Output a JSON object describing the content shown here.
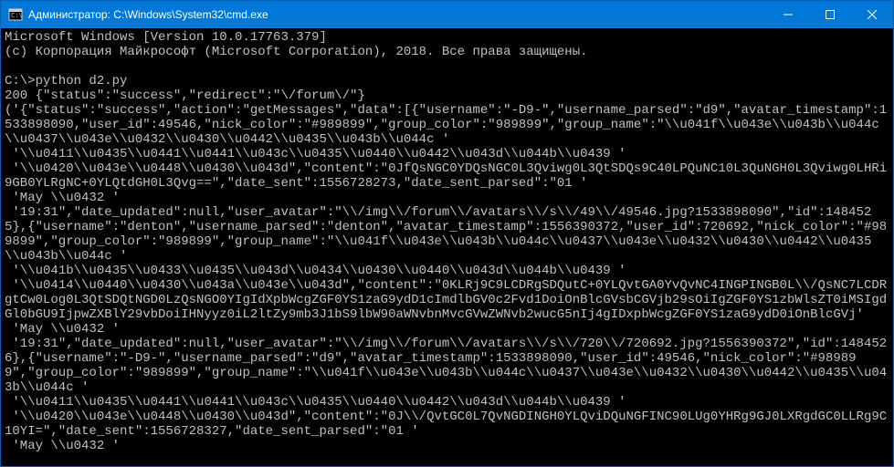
{
  "titlebar": {
    "title": "Администратор: C:\\Windows\\System32\\cmd.exe"
  },
  "terminal": {
    "lines": [
      "Microsoft Windows [Version 10.0.17763.379]",
      "(c) Корпорация Майкрософт (Microsoft Corporation), 2018. Все права защищены.",
      "",
      "C:\\>python d2.py",
      "200 {\"status\":\"success\",\"redirect\":\"\\/forum\\/\"}",
      "('{\"status\":\"success\",\"action\":\"getMessages\",\"data\":[{\"username\":\"-D9-\",\"username_parsed\":\"d9\",\"avatar_timestamp\":1533898090,\"user_id\":49546,\"nick_color\":\"#989899\",\"group_color\":\"989899\",\"group_name\":\"\\\\u041f\\\\u043e\\\\u043b\\\\u044c\\\\u0437\\\\u043e\\\\u0432\\\\u0430\\\\u0442\\\\u0435\\\\u043b\\\\u044c '",
      " '\\\\u0411\\\\u0435\\\\u0441\\\\u0441\\\\u043c\\\\u0435\\\\u0440\\\\u0442\\\\u043d\\\\u044b\\\\u0439 '",
      " '\\\\u0420\\\\u043e\\\\u0448\\\\u0430\\\\u043d\",\"content\":\"0JfQsNGC0YDQsNGC0L3Qviwg0L3QtSDQs9C40LPQuNC10L3QuNGH0L3Qviwg0LHRi9GB0YLRgNC+0YLQtdGH0L3Qvg==\",\"date_sent\":1556728273,\"date_sent_parsed\":\"01 '",
      " 'May \\\\u0432 '",
      " '19:31\",\"date_updated\":null,\"user_avatar\":\"\\\\/img\\\\/forum\\\\/avatars\\\\/s\\\\/49\\\\/49546.jpg?1533898090\",\"id\":1484525},{\"username\":\"denton\",\"username_parsed\":\"denton\",\"avatar_timestamp\":1556390372,\"user_id\":720692,\"nick_color\":\"#989899\",\"group_color\":\"989899\",\"group_name\":\"\\\\u041f\\\\u043e\\\\u043b\\\\u044c\\\\u0437\\\\u043e\\\\u0432\\\\u0430\\\\u0442\\\\u0435\\\\u043b\\\\u044c '",
      " '\\\\u041b\\\\u0435\\\\u0433\\\\u0435\\\\u043d\\\\u0434\\\\u0430\\\\u0440\\\\u043d\\\\u044b\\\\u0439 '",
      " '\\\\u0414\\\\u0440\\\\u0430\\\\u043a\\\\u043e\\\\u043d\",\"content\":\"0KLRj9C9LCDRgSDQutC+0YLQvtGA0YvQvNC4INGPINGB0L\\\\/QsNC7LCDRgtCw0Log0L3QtSDQtNGD0LzQsNGO0YIgIdXpbWcgZGF0YS1zaG9ydD1cImdlbGV0c2Fvd1DoiOnBlcGVsbCGVjb29sOiIgZGF0YS1zbWlsZT0iMSIgdGl0bGU9IjpwZXBlY29vbDoiIHNyyz0iL2ltZy9mb3J1bS9lbW90aWNvbnMvcGVwZWNvb2wucG5nIj4gIDxpbWcgZGF0YS1zaG9ydD0iOnBlcGVj'",
      " 'May \\\\u0432 '",
      " '19:31\",\"date_updated\":null,\"user_avatar\":\"\\\\/img\\\\/forum\\\\/avatars\\\\/s\\\\/720\\\\/720692.jpg?1556390372\",\"id\":1484526},{\"username\":\"-D9-\",\"username_parsed\":\"d9\",\"avatar_timestamp\":1533898090,\"user_id\":49546,\"nick_color\":\"#989899\",\"group_color\":\"989899\",\"group_name\":\"\\\\u041f\\\\u043e\\\\u043b\\\\u044c\\\\u0437\\\\u043e\\\\u0432\\\\u0430\\\\u0442\\\\u0435\\\\u043b\\\\u044c '",
      " '\\\\u0411\\\\u0435\\\\u0441\\\\u0441\\\\u043c\\\\u0435\\\\u0440\\\\u0442\\\\u043d\\\\u044b\\\\u0439 '",
      " '\\\\u0420\\\\u043e\\\\u0448\\\\u0430\\\\u043d\",\"content\":\"0J\\\\/QvtGC0L7QvNGDINGH0YLQviDQuNGFINC90LUg0YHRg9GJ0LXRgdGC0LLRg9C10YI=\",\"date_sent\":1556728327,\"date_sent_parsed\":\"01 '",
      " 'May \\\\u0432 '"
    ]
  }
}
